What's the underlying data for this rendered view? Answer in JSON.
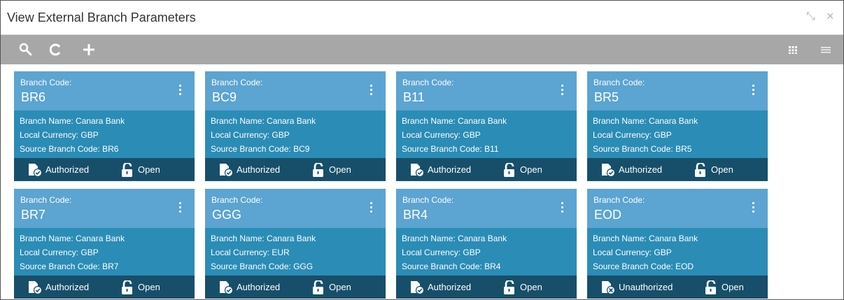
{
  "window": {
    "title": "View External Branch Parameters",
    "minimize_symbol": "⤡",
    "close_symbol": "×"
  },
  "toolbar": {
    "icons": [
      "search-icon",
      "refresh-icon",
      "add-icon"
    ],
    "view_icons": [
      "grid-view-icon",
      "list-view-icon"
    ]
  },
  "labels": {
    "branch_code": "Branch Code:",
    "open": "Open"
  },
  "cards": [
    {
      "code": "BR6",
      "name_line": "Branch Name: Canara Bank",
      "currency_line": "Local Currency: GBP",
      "source_line": "Source Branch Code: BR6",
      "status": "Authorized"
    },
    {
      "code": "BC9",
      "name_line": "Branch Name: Canara Bank",
      "currency_line": "Local Currency: GBP",
      "source_line": "Source Branch Code: BC9",
      "status": "Authorized"
    },
    {
      "code": "B11",
      "name_line": "Branch Name: Canara Bank",
      "currency_line": "Local Currency: GBP",
      "source_line": "Source Branch Code: B11",
      "status": "Authorized"
    },
    {
      "code": "BR5",
      "name_line": "Branch Name: Canara Bank",
      "currency_line": "Local Currency: GBP",
      "source_line": "Source Branch Code: BR5",
      "status": "Authorized"
    },
    {
      "code": "BR7",
      "name_line": "Branch Name: Canara Bank",
      "currency_line": "Local Currency: GBP",
      "source_line": "Source Branch Code: BR7",
      "status": "Authorized"
    },
    {
      "code": "GGG",
      "name_line": "Branch Name: Canara Bank",
      "currency_line": "Local Currency: EUR",
      "source_line": "Source Branch Code: GGG",
      "status": "Authorized"
    },
    {
      "code": "BR4",
      "name_line": "Branch Name: Canara Bank",
      "currency_line": "Local Currency: GBP",
      "source_line": "Source Branch Code: BR4",
      "status": "Authorized"
    },
    {
      "code": "EOD",
      "name_line": "Branch Name: Canara Bank",
      "currency_line": "Local Currency: GBP",
      "source_line": "Source Branch Code: EOD",
      "status": "Unauthorized"
    }
  ],
  "colors": {
    "toolbar": "#a7a7a7",
    "card_header": "#5ca4d1",
    "card_body": "#2b8cb6",
    "card_footer": "#174f6a"
  }
}
